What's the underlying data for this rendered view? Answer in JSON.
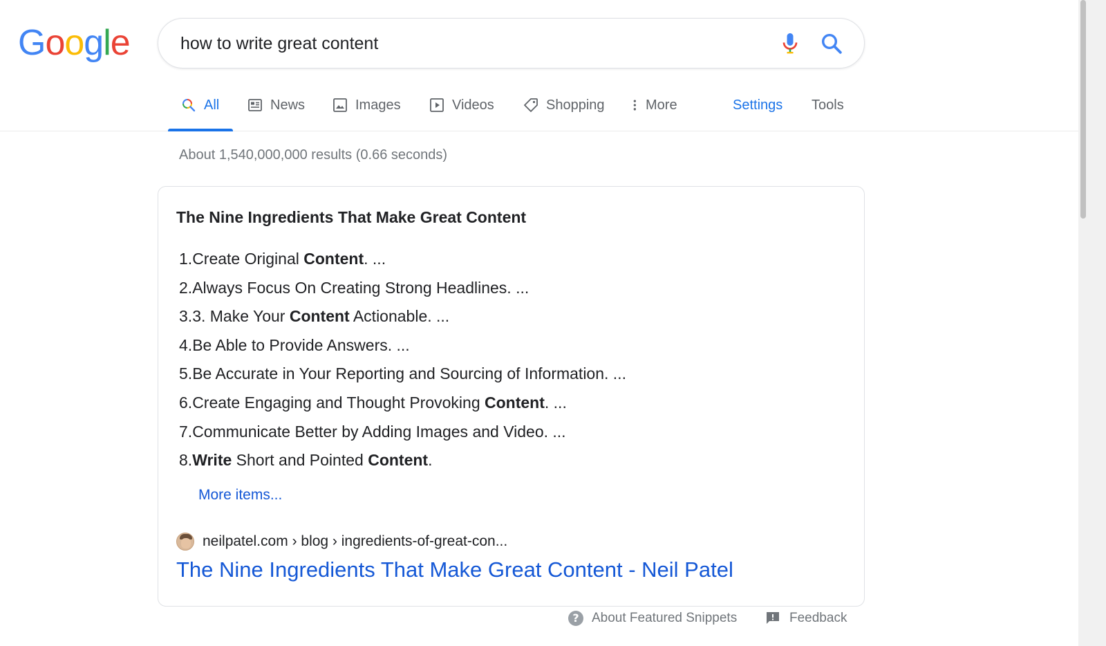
{
  "logo": {
    "letters": [
      "G",
      "o",
      "o",
      "g",
      "l",
      "e"
    ],
    "colors": [
      "#4285f4",
      "#ea4335",
      "#fbbc05",
      "#4285f4",
      "#34a853",
      "#ea4335"
    ]
  },
  "search": {
    "query": "how to write great content",
    "mic_icon": "mic-icon",
    "search_icon": "search-icon"
  },
  "tabs": [
    {
      "label": "All",
      "icon": "search-icon",
      "active": true
    },
    {
      "label": "News",
      "icon": "news-icon"
    },
    {
      "label": "Images",
      "icon": "image-icon"
    },
    {
      "label": "Videos",
      "icon": "play-icon"
    },
    {
      "label": "Shopping",
      "icon": "tag-icon"
    },
    {
      "label": "More",
      "icon": "more-vert-icon"
    },
    {
      "label": "Settings"
    },
    {
      "label": "Tools"
    }
  ],
  "stats": "About 1,540,000,000 results (0.66 seconds)",
  "snippet": {
    "title": "The Nine Ingredients That Make Great Content",
    "items": [
      {
        "num": "1. ",
        "parts": [
          {
            "t": "Create Original "
          },
          {
            "t": "Content",
            "b": true
          },
          {
            "t": ". ..."
          }
        ]
      },
      {
        "num": "2. ",
        "parts": [
          {
            "t": "Always Focus On Creating Strong Headlines. ..."
          }
        ]
      },
      {
        "num": "3. ",
        "parts": [
          {
            "t": "3. Make Your "
          },
          {
            "t": "Content",
            "b": true
          },
          {
            "t": " Actionable. ..."
          }
        ]
      },
      {
        "num": "4. ",
        "parts": [
          {
            "t": "Be Able to Provide Answers. ..."
          }
        ]
      },
      {
        "num": "5. ",
        "parts": [
          {
            "t": "Be Accurate in Your Reporting and Sourcing of Information. ..."
          }
        ]
      },
      {
        "num": "6. ",
        "parts": [
          {
            "t": "Create Engaging and Thought Provoking "
          },
          {
            "t": "Content",
            "b": true
          },
          {
            "t": ". ..."
          }
        ]
      },
      {
        "num": "7. ",
        "parts": [
          {
            "t": "Communicate Better by Adding Images and Video. ..."
          }
        ]
      },
      {
        "num": "8. ",
        "parts": [
          {
            "t": "Write",
            "b": true
          },
          {
            "t": " Short and Pointed "
          },
          {
            "t": "Content",
            "b": true
          },
          {
            "t": "."
          }
        ]
      }
    ],
    "more_items": "More items...",
    "source_breadcrumb": "neilpatel.com › blog › ingredients-of-great-con...",
    "result_title": "The Nine Ingredients That Make Great Content - Neil Patel"
  },
  "footer": {
    "about": "About Featured Snippets",
    "feedback": "Feedback"
  },
  "colors": {
    "link": "#1558d6",
    "accent": "#1a73e8",
    "muted": "#70757a"
  }
}
